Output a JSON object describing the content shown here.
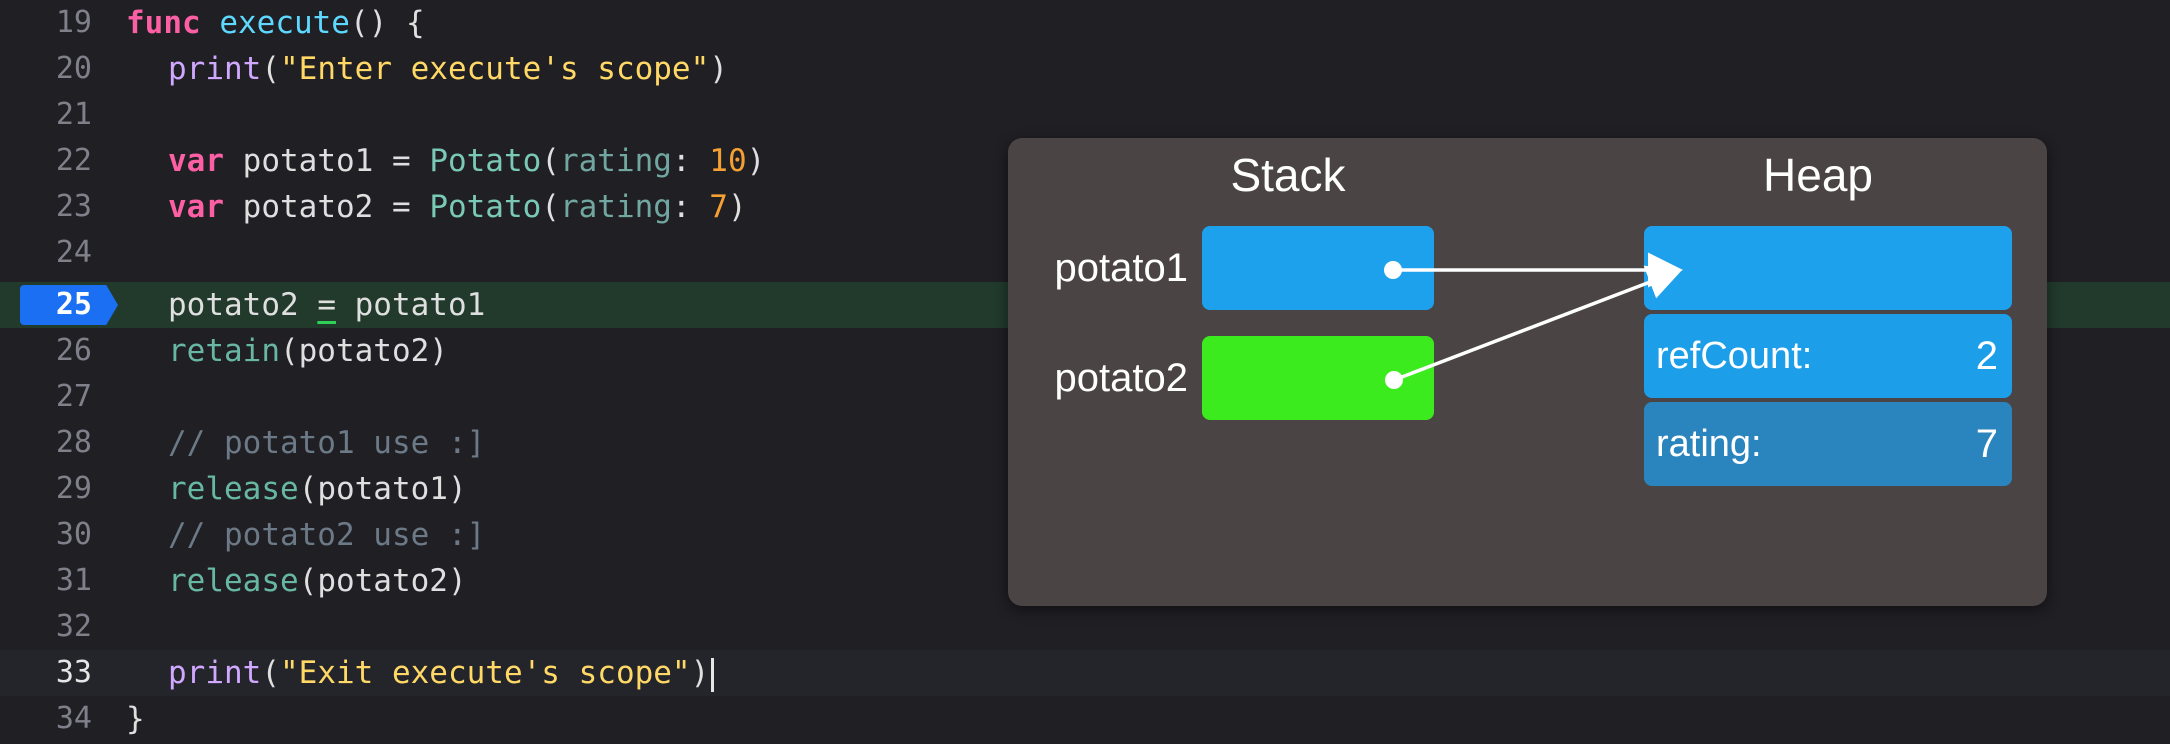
{
  "editor": {
    "lines": [
      {
        "num": "19",
        "tokens": [
          "func",
          "execute",
          "() {"
        ]
      },
      {
        "num": "20",
        "tokens": [
          "print",
          "(",
          "\"Enter execute's scope\"",
          ")"
        ]
      },
      {
        "num": "21",
        "tokens": []
      },
      {
        "num": "22",
        "tokens": [
          "var",
          " potato1 = ",
          "Potato",
          "(",
          "rating",
          ": ",
          "10",
          ")"
        ]
      },
      {
        "num": "23",
        "tokens": [
          "var",
          " potato2 = ",
          "Potato",
          "(",
          "rating",
          ": ",
          "7",
          ")"
        ]
      },
      {
        "num": "24",
        "tokens": []
      },
      {
        "num": "25",
        "tokens": [
          "potato2 ",
          "=",
          " potato1"
        ]
      },
      {
        "num": "26",
        "tokens": [
          "retain",
          "(potato2)"
        ]
      },
      {
        "num": "27",
        "tokens": []
      },
      {
        "num": "28",
        "tokens": [
          "// potato1 use :]"
        ]
      },
      {
        "num": "29",
        "tokens": [
          "release",
          "(potato1)"
        ]
      },
      {
        "num": "30",
        "tokens": [
          "// potato2 use :]"
        ]
      },
      {
        "num": "31",
        "tokens": [
          "release",
          "(potato2)"
        ]
      },
      {
        "num": "32",
        "tokens": []
      },
      {
        "num": "33",
        "tokens": [
          "print",
          "(",
          "\"Exit execute's scope\"",
          ")"
        ]
      },
      {
        "num": "34",
        "tokens": [
          "}"
        ]
      }
    ],
    "breakpoint_line": "25",
    "current_line": "33"
  },
  "diagram": {
    "stack_title": "Stack",
    "heap_title": "Heap",
    "variables": [
      {
        "name": "potato1",
        "color": "#1da1ec"
      },
      {
        "name": "potato2",
        "color": "#3ceb1d"
      }
    ],
    "heap_fields": [
      {
        "label": "refCount:",
        "value": "2"
      },
      {
        "label": "rating:",
        "value": "7"
      }
    ],
    "arrow_color": "#ffffff"
  }
}
